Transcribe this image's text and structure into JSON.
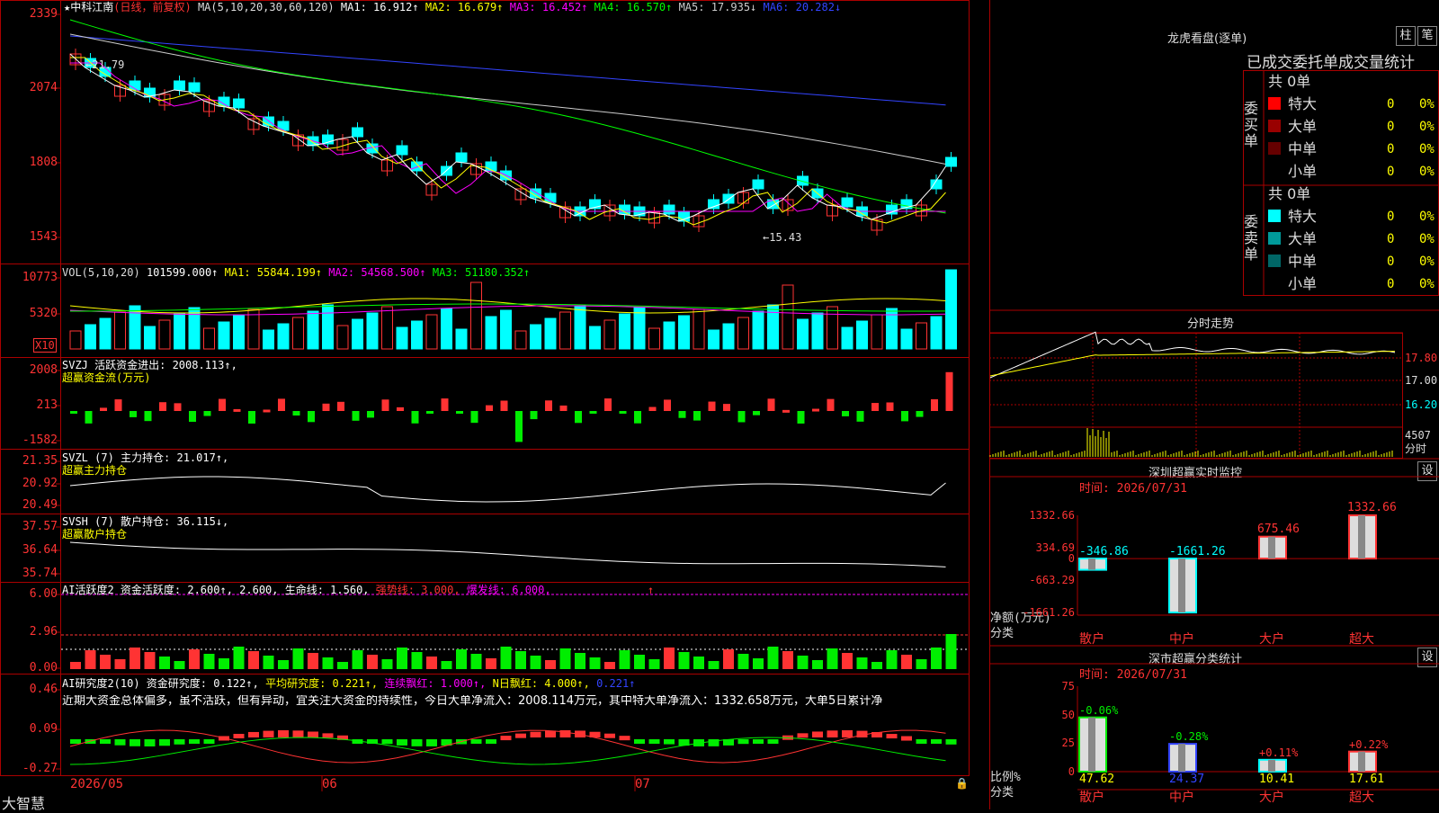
{
  "main_header": {
    "star": "★",
    "stock_name": "中科江南",
    "period": "(日线，前复权)",
    "ma_params": "MA(5,10,20,30,60,120)",
    "ma_values": [
      {
        "label": "MA1: 16.912↑",
        "color": "#ffffff"
      },
      {
        "label": "MA2: 16.679↑",
        "color": "#ffff00"
      },
      {
        "label": "MA3: 16.452↑",
        "color": "#ff00ff"
      },
      {
        "label": "MA4: 16.570↑",
        "color": "#00ff00"
      },
      {
        "label": "MA5: 17.935↓",
        "color": "#cccccc"
      },
      {
        "label": "MA6: 20.282↓",
        "color": "#3344ff"
      }
    ]
  },
  "main_chart": {
    "y_ticks": [
      "2339",
      "2074",
      "1808",
      "1543"
    ],
    "high_mark": "←21.79",
    "low_mark": "←15.43"
  },
  "vol_panel": {
    "title": "VOL(5,10,20)",
    "value": "101599.000↑",
    "ma": [
      {
        "label": "MA1: 55844.199↑",
        "color": "#ffff00"
      },
      {
        "label": "MA2: 54568.500↑",
        "color": "#ff00ff"
      },
      {
        "label": "MA3: 51180.352↑",
        "color": "#00ff00"
      }
    ],
    "y_ticks": [
      "10773",
      "5320"
    ],
    "unit": "X10"
  },
  "svzj_panel": {
    "line1": "SVZJ  活跃资金进出: 2008.113↑,",
    "line2": "超赢资金流(万元)",
    "y_ticks": [
      "2008",
      "213",
      "-1582"
    ]
  },
  "svzl_panel": {
    "line1": "SVZL (7) 主力持仓: 21.017↑,",
    "line2": "超赢主力持仓",
    "y_ticks": [
      "21.35",
      "20.92",
      "20.49"
    ]
  },
  "svsh_panel": {
    "line1": "SVSH (7) 散户持仓: 36.115↓,",
    "line2": "超赢散户持仓",
    "y_ticks": [
      "37.57",
      "36.64",
      "35.74"
    ]
  },
  "ai_active_panel": {
    "title": "AI活跃度2 资金活跃度: 2.600↑, 2.600, 生命线: 1.560,",
    "strong": "强势线: 3.000,",
    "burst": "爆发线: 6.000,",
    "arrow": "↑",
    "y_ticks": [
      "6.00",
      "2.96",
      "0.00"
    ]
  },
  "ai_research_panel": {
    "title": "AI研究度2(10) 资金研究度: 0.122↑,",
    "avg": "平均研究度: 0.221↑,",
    "cont_red": "连续飘红: 1.000↑,",
    "n_red": "N日飘红: 4.000↑,",
    "extra": "0.221↑",
    "comment": "近期大资金总体偏多，虽不活跃，但有异动，宜关注大资金的持续性，今日大单净流入：2008.114万元，其中特大单净流入：1332.658万元，大单5日累计净",
    "y_ticks": [
      "0.46",
      "0.09",
      "-0.27"
    ]
  },
  "x_axis": {
    "labels": [
      "2026/05",
      "06",
      "07"
    ]
  },
  "logo": "大智慧",
  "lhb": {
    "title": "龙虎看盘(逐单)",
    "btn_column": "柱",
    "btn_stroke": "笔",
    "subtitle": "已成交委托单成交量统计",
    "buy_side": "委买单",
    "sell_side": "委卖单",
    "buy_total": "共 0单",
    "sell_total": "共 0单",
    "buy_rows": [
      {
        "label": "特大",
        "count": "0",
        "pct": "0%",
        "color": "#ff0000"
      },
      {
        "label": "大单",
        "count": "0",
        "pct": "0%",
        "color": "#990000"
      },
      {
        "label": "中单",
        "count": "0",
        "pct": "0%",
        "color": "#660000"
      },
      {
        "label": "小单",
        "count": "0",
        "pct": "0%",
        "color": "#000000"
      }
    ],
    "sell_rows": [
      {
        "label": "特大",
        "count": "0",
        "pct": "0%",
        "color": "#00ffff"
      },
      {
        "label": "大单",
        "count": "0",
        "pct": "0%",
        "color": "#009999"
      },
      {
        "label": "中单",
        "count": "0",
        "pct": "0%",
        "color": "#006666"
      },
      {
        "label": "小单",
        "count": "0",
        "pct": "0%",
        "color": "#000000"
      }
    ]
  },
  "intraday": {
    "title": "分时走势",
    "price_ticks": [
      "17.80",
      "17.00",
      "16.20"
    ],
    "vol_tick": "4507",
    "vol_unit": "分时"
  },
  "sz_monitor": {
    "title": "深圳超赢实时监控",
    "btn": "设",
    "time": "时间: 2026/07/31",
    "y_ticks": [
      "1332.66",
      "334.69",
      "0",
      "-663.29",
      "-1661.26"
    ],
    "y_title": "净额(万元)",
    "x_title": "分类",
    "chart_data": {
      "type": "bar",
      "categories": [
        "散户",
        "中户",
        "大户",
        "超大"
      ],
      "values": [
        -346.86,
        -1661.26,
        675.46,
        1332.66
      ],
      "value_labels": [
        "-346.86",
        "-1661.26",
        "675.46",
        "1332.66"
      ],
      "ylim": [
        -1661.26,
        1332.66
      ]
    }
  },
  "sz_class": {
    "title": "深市超赢分类统计",
    "btn": "设",
    "time": "时间: 2026/07/31",
    "y_ticks": [
      "75",
      "50",
      "25",
      "0"
    ],
    "y_title": "比例%",
    "x_title": "分类",
    "chart_data": {
      "type": "bar",
      "categories": [
        "散户",
        "中户",
        "大户",
        "超大"
      ],
      "values": [
        47.62,
        24.37,
        10.41,
        17.61
      ],
      "value_labels": [
        "47.62",
        "24.37",
        "10.41",
        "17.61"
      ],
      "changes": [
        "-0.06%",
        "-0.28%",
        "+0.11%",
        "+0.22%"
      ],
      "ylim": [
        0,
        75
      ]
    }
  }
}
